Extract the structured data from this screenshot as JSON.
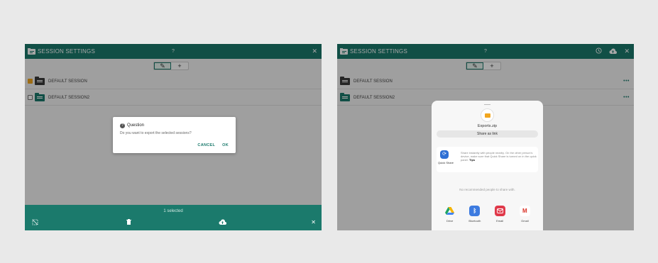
{
  "left": {
    "title": "SESSION SETTINGS",
    "help": "?",
    "close": "✕",
    "tools": {
      "edit": "✎",
      "add": "+"
    },
    "sessions": [
      {
        "name": "DEFAULT SESSION",
        "checked": true
      },
      {
        "name": "DEFAULT SESSION2",
        "checked": false
      }
    ],
    "dialog": {
      "title": "Question",
      "message": "Do you want to export the selected sessions?",
      "cancel": "CANCEL",
      "ok": "OK"
    },
    "bottom": {
      "selected": "1 selected",
      "close": "✕"
    }
  },
  "right": {
    "title": "SESSION SETTINGS",
    "help": "?",
    "close": "✕",
    "tools": {
      "edit": "✎",
      "add": "+"
    },
    "sessions": [
      {
        "name": "DEFAULT SESSION",
        "more": "•••"
      },
      {
        "name": "DEFAULT SESSION2",
        "more": "•••"
      }
    ],
    "share": {
      "file_name": "Exports.zip",
      "share_link": "Share as link",
      "quick_share_label": "Quick Share",
      "quick_share_text": "Share instantly with people nearby. On the other person's device, make sure that Quick Share is turned on in the quick panel.",
      "tips": "Tips",
      "no_recommended": "No recommended people to share with.",
      "apps": [
        {
          "name": "Drive",
          "icon": "drive-icon",
          "color": "#1ea362"
        },
        {
          "name": "Bluetooth",
          "icon": "bluetooth-icon",
          "color": "#3d7be0"
        },
        {
          "name": "Email",
          "icon": "email-icon",
          "color": "#e0394a"
        },
        {
          "name": "Gmail",
          "icon": "gmail-icon",
          "color": "#d93025"
        }
      ]
    }
  }
}
